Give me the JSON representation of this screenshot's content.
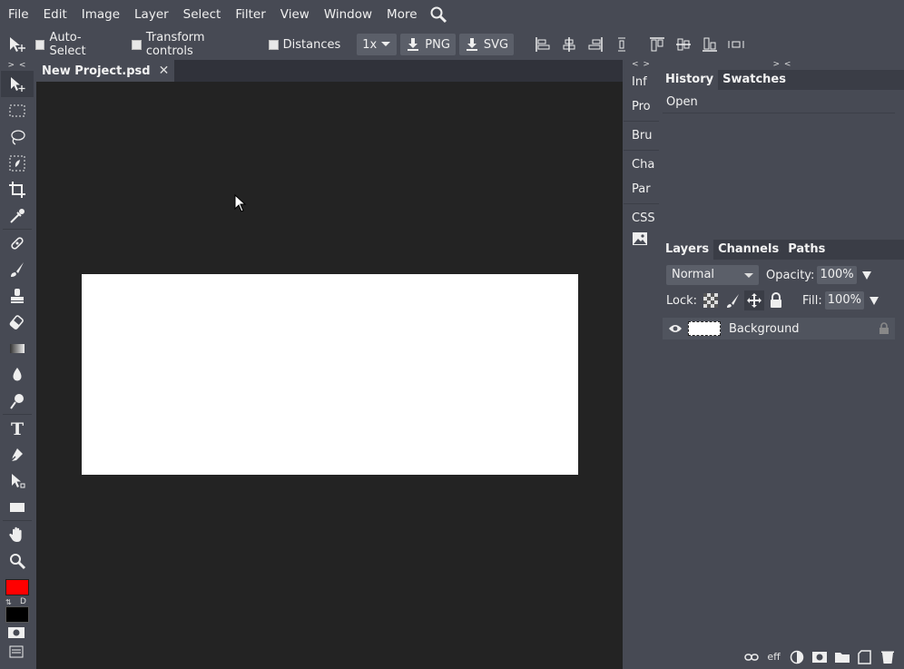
{
  "menu": {
    "items": [
      "File",
      "Edit",
      "Image",
      "Layer",
      "Select",
      "Filter",
      "View",
      "Window",
      "More"
    ],
    "search_icon": "search-icon"
  },
  "options_bar": {
    "auto_select": "Auto-Select",
    "transform_controls": "Transform controls",
    "distances": "Distances",
    "zoom": "1x",
    "png": "PNG",
    "svg": "SVG"
  },
  "toolbar": {
    "collapse": "> <",
    "tools": [
      "move-tool-icon",
      "marquee-tool-icon",
      "lasso-tool-icon",
      "quick-select-tool-icon",
      "crop-tool-icon",
      "eyedropper-tool-icon",
      "healing-tool-icon",
      "brush-tool-icon",
      "stamp-tool-icon",
      "eraser-tool-icon",
      "gradient-tool-icon",
      "blur-tool-icon",
      "dodge-tool-icon",
      "type-tool-icon",
      "pen-tool-icon",
      "path-select-tool-icon",
      "rectangle-tool-icon",
      "hand-tool-icon",
      "zoom-tool-icon"
    ],
    "foreground_color": "#ff0000",
    "background_color": "#000000",
    "swap_label": "⇅",
    "default_label": "D"
  },
  "document": {
    "tab_title": "New Project.psd",
    "close_label": "✕",
    "canvas_color": "#ffffff"
  },
  "mini_panels": {
    "collapse": "< >",
    "buttons": [
      "Inf",
      "Pro",
      "Bru",
      "Cha",
      "Par",
      "CSS"
    ]
  },
  "right_panels": {
    "collapse": "> <",
    "history_tabs": [
      "History",
      "Swatches"
    ],
    "history_items": [
      "Open"
    ],
    "layers_tabs": [
      "Layers",
      "Channels",
      "Paths"
    ],
    "blend_mode": "Normal",
    "opacity_label": "Opacity:",
    "opacity_value": "100%",
    "lock_label": "Lock:",
    "fill_label": "Fill:",
    "fill_value": "100%",
    "layers": [
      {
        "name": "Background",
        "visible": true,
        "locked": true
      }
    ],
    "footer_eff": "eff"
  }
}
